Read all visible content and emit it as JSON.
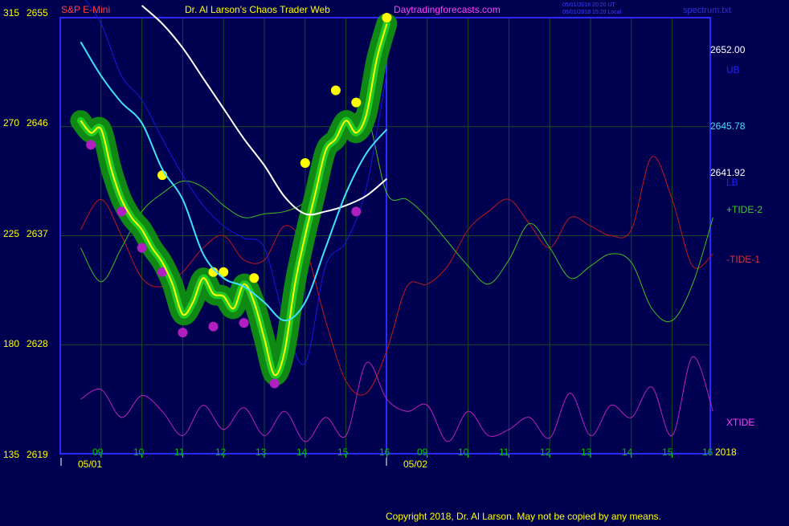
{
  "header": {
    "symbol": "S&P E-Mini",
    "title": "Dr. Al Larson's Chaos Trader Web",
    "site": "Daytradingforecasts.com",
    "timestamp_ut": "05/01/2018 20:20 UT",
    "timestamp_local": "05/01/2018 15:20 Local",
    "file": "spectrum.txt"
  },
  "copyright": "Copyright 2018, Dr. Al Larson. May not be copied by any means.",
  "colors": {
    "background": "#000050",
    "frame": "#2a2aff",
    "grid": "#1a4a28",
    "price": "#ffff00",
    "ema_fast": "#40e0ff",
    "ema_slow": "#ffffff",
    "ub": "#1818e0",
    "lb": "#1818e0",
    "tide2": "#40c020",
    "tide1": "#c01818",
    "xtide": "#c020c0",
    "highs": "#ffff00",
    "lows": "#b020c0",
    "band": "#109010",
    "ticks": "#00ff00"
  },
  "chart_data": {
    "type": "line",
    "title": "",
    "left_axis": {
      "secondary_ticks": [
        "315",
        "270",
        "225",
        "180",
        "135"
      ],
      "price_ticks": [
        "2655",
        "2646",
        "2637",
        "2628",
        "2619"
      ],
      "ylim": [
        2619,
        2655
      ]
    },
    "x_axis": {
      "hour_labels": [
        "09",
        "10",
        "11",
        "12",
        "13",
        "14",
        "15",
        "16",
        "09",
        "10",
        "11",
        "12",
        "13",
        "14",
        "15",
        "16"
      ],
      "date_labels": [
        "05/01",
        "05/02"
      ],
      "year_label": "2018"
    },
    "right_labels": {
      "ub_value": "2652.00",
      "ub_name": "UB",
      "ema_value": "2645.78",
      "lb_value": "2641.92",
      "lb_name": "LB",
      "tide2_name": "+TIDE-2",
      "tide1_name": "-TIDE-1",
      "xtide_name": "XTIDE"
    },
    "series": [
      {
        "name": "S&P E-Mini",
        "x": [
          "05/01 08:30",
          "05/01 08:45",
          "05/01 09:00",
          "05/01 09:15",
          "05/01 09:30",
          "05/01 09:45",
          "05/01 10:00",
          "05/01 10:15",
          "05/01 10:30",
          "05/01 10:45",
          "05/01 11:00",
          "05/01 11:15",
          "05/01 11:30",
          "05/01 11:45",
          "05/01 12:00",
          "05/01 12:15",
          "05/01 12:30",
          "05/01 12:45",
          "05/01 13:00",
          "05/01 13:15",
          "05/01 13:30",
          "05/01 13:45",
          "05/01 14:00",
          "05/01 14:15",
          "05/01 14:30",
          "05/01 14:45",
          "05/01 15:00",
          "05/01 15:15",
          "05/01 15:30",
          "05/01 15:45",
          "05/01 16:00"
        ],
        "y": [
          2646.5,
          2645.5,
          2645.8,
          2642.5,
          2640.0,
          2638.5,
          2637.5,
          2636.0,
          2634.8,
          2633.0,
          2630.5,
          2631.5,
          2633.5,
          2632.2,
          2632.0,
          2631.0,
          2633.0,
          2631.5,
          2628.5,
          2625.5,
          2627.5,
          2633.0,
          2637.0,
          2640.5,
          2644.0,
          2645.0,
          2646.5,
          2645.5,
          2647.0,
          2651.5,
          2654.5
        ]
      },
      {
        "name": "fast average",
        "x": [
          "05/01 08:30",
          "05/01 09:00",
          "05/01 09:30",
          "05/01 10:00",
          "05/01 10:30",
          "05/01 11:00",
          "05/01 11:30",
          "05/01 12:00",
          "05/01 12:30",
          "05/01 13:00",
          "05/01 13:30",
          "05/01 14:00",
          "05/01 14:30",
          "05/01 15:00",
          "05/01 15:30",
          "05/01 16:00"
        ],
        "y": [
          2653.0,
          2650.2,
          2648.0,
          2646.3,
          2642.5,
          2640.0,
          2635.5,
          2633.5,
          2632.8,
          2631.5,
          2630.0,
          2631.5,
          2636.0,
          2640.5,
          2643.8,
          2645.78
        ]
      },
      {
        "name": "slow average",
        "x": [
          "05/01 10:00",
          "05/01 10:30",
          "05/01 11:00",
          "05/01 11:30",
          "05/01 12:00",
          "05/01 12:30",
          "05/01 13:00",
          "05/01 13:30",
          "05/01 14:00",
          "05/01 14:30",
          "05/01 15:00",
          "05/01 15:30",
          "05/01 16:00"
        ],
        "y": [
          2656.0,
          2654.5,
          2652.5,
          2650.0,
          2647.5,
          2645.0,
          2642.8,
          2640.2,
          2638.8,
          2639.0,
          2639.5,
          2640.3,
          2641.7
        ]
      },
      {
        "name": "UB",
        "x": [
          "05/01 08:30",
          "05/01 09:00",
          "05/01 09:30",
          "05/01 10:00",
          "05/01 10:30",
          "05/01 11:00",
          "05/01 11:30",
          "05/01 12:00",
          "05/01 12:30",
          "05/01 13:00",
          "05/01 13:30",
          "05/01 14:00",
          "05/01 14:30",
          "05/01 15:00",
          "05/01 15:30",
          "05/01 16:00"
        ],
        "y": [
          2657.0,
          2654.5,
          2650.2,
          2648.2,
          2645.0,
          2642.0,
          2639.5,
          2637.8,
          2636.8,
          2636.0,
          2630.0,
          2626.5,
          2634.5,
          2636.5,
          2641.0,
          2650.5
        ]
      },
      {
        "name": "+TIDE-2",
        "x": [
          "05/01 08:30",
          "05/01 09:00",
          "05/01 09:30",
          "05/01 10:00",
          "05/01 10:30",
          "05/01 11:00",
          "05/01 11:30",
          "05/01 12:00",
          "05/01 12:30",
          "05/01 13:00",
          "05/01 13:30",
          "05/01 14:00",
          "05/01 14:30",
          "05/01 15:00",
          "05/01 15:30",
          "05/01 16:00",
          "05/02 08:30",
          "05/02 09:00",
          "05/02 09:30",
          "05/02 10:00",
          "05/02 10:30",
          "05/02 11:00",
          "05/02 11:30",
          "05/02 12:00",
          "05/02 12:30",
          "05/02 13:00",
          "05/02 13:30",
          "05/02 14:00",
          "05/02 14:30",
          "05/02 15:00",
          "05/02 15:30",
          "05/02 16:00"
        ],
        "y": [
          2636.0,
          2633.2,
          2636.0,
          2639.0,
          2640.5,
          2641.5,
          2641.0,
          2639.5,
          2638.5,
          2638.8,
          2639.0,
          2639.8,
          2642.0,
          2646.0,
          2647.0,
          2640.5,
          2640.0,
          2638.5,
          2636.5,
          2634.5,
          2633.0,
          2635.0,
          2638.0,
          2636.0,
          2633.5,
          2634.5,
          2635.5,
          2634.8,
          2631.0,
          2630.0,
          2633.0,
          2638.5
        ]
      },
      {
        "name": "-TIDE-1",
        "x": [
          "05/01 08:30",
          "05/01 09:00",
          "05/01 09:30",
          "05/01 10:00",
          "05/01 10:30",
          "05/01 11:00",
          "05/01 11:30",
          "05/01 12:00",
          "05/01 12:30",
          "05/01 13:00",
          "05/01 13:30",
          "05/01 14:00",
          "05/01 14:30",
          "05/01 15:00",
          "05/01 15:30",
          "05/01 16:00",
          "05/02 08:30",
          "05/02 09:00",
          "05/02 09:30",
          "05/02 10:00",
          "05/02 10:30",
          "05/02 11:00",
          "05/02 11:30",
          "05/02 12:00",
          "05/02 12:30",
          "05/02 13:00",
          "05/02 13:30",
          "05/02 14:00",
          "05/02 14:30",
          "05/02 15:00",
          "05/02 15:30",
          "05/02 16:00"
        ],
        "y": [
          2637.5,
          2640.0,
          2637.0,
          2633.5,
          2632.8,
          2634.0,
          2636.0,
          2637.0,
          2635.0,
          2635.0,
          2637.8,
          2636.0,
          2630.0,
          2625.0,
          2624.0,
          2627.5,
          2632.8,
          2633.0,
          2634.5,
          2637.5,
          2639.0,
          2640.0,
          2638.0,
          2636.0,
          2638.5,
          2637.8,
          2637.0,
          2637.5,
          2643.5,
          2640.0,
          2634.5,
          2635.5
        ]
      },
      {
        "name": "XTIDE",
        "x": [
          "05/01 08:30",
          "05/01 09:00",
          "05/01 09:30",
          "05/01 10:00",
          "05/01 10:30",
          "05/01 11:00",
          "05/01 11:30",
          "05/01 12:00",
          "05/01 12:30",
          "05/01 13:00",
          "05/01 13:30",
          "05/01 14:00",
          "05/01 14:30",
          "05/01 15:00",
          "05/01 15:30",
          "05/01 16:00",
          "05/02 08:30",
          "05/02 09:00",
          "05/02 09:30",
          "05/02 10:00",
          "05/02 10:30",
          "05/02 11:00",
          "05/02 11:30",
          "05/02 12:00",
          "05/02 12:30",
          "05/02 13:00",
          "05/02 13:30",
          "05/02 14:00",
          "05/02 14:30",
          "05/02 15:00",
          "05/02 15:30",
          "05/02 16:00"
        ],
        "y": [
          2623.5,
          2624.3,
          2622.0,
          2623.8,
          2622.5,
          2620.5,
          2623.0,
          2621.0,
          2622.8,
          2620.5,
          2622.5,
          2620.0,
          2622.0,
          2620.5,
          2626.5,
          2623.5,
          2622.5,
          2623.0,
          2620.0,
          2622.5,
          2620.5,
          2621.0,
          2622.0,
          2620.3,
          2624.0,
          2620.5,
          2623.0,
          2622.0,
          2624.5,
          2620.5,
          2627.0,
          2622.5
        ]
      }
    ],
    "highs": [
      {
        "x": "05/01 10:30",
        "y": 2642.0
      },
      {
        "x": "05/01 11:45",
        "y": 2634.0
      },
      {
        "x": "05/01 12:00",
        "y": 2634.0
      },
      {
        "x": "05/01 12:45",
        "y": 2633.5
      },
      {
        "x": "05/01 14:00",
        "y": 2643.0
      },
      {
        "x": "05/01 14:45",
        "y": 2649.0
      },
      {
        "x": "05/01 15:15",
        "y": 2648.0
      },
      {
        "x": "05/01 16:00",
        "y": 2655.0
      }
    ],
    "lows": [
      {
        "x": "05/01 08:45",
        "y": 2644.5
      },
      {
        "x": "05/01 09:30",
        "y": 2639.0
      },
      {
        "x": "05/01 10:00",
        "y": 2636.0
      },
      {
        "x": "05/01 10:30",
        "y": 2634.0
      },
      {
        "x": "05/01 11:00",
        "y": 2629.0
      },
      {
        "x": "05/01 11:45",
        "y": 2629.5
      },
      {
        "x": "05/01 12:30",
        "y": 2629.8
      },
      {
        "x": "05/01 13:15",
        "y": 2624.8
      },
      {
        "x": "05/01 15:15",
        "y": 2639.0
      }
    ],
    "grid": true
  }
}
